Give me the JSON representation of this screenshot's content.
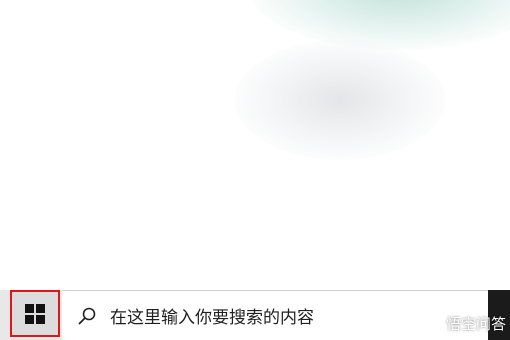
{
  "taskbar": {
    "start_icon": "windows-logo-icon",
    "search": {
      "icon": "search-icon",
      "placeholder": "在这里输入你要搜索的内容"
    }
  },
  "watermark": {
    "text": "悟空问答"
  },
  "colors": {
    "highlight_border": "#e0151b",
    "taskbar_bg": "#e8e8e8",
    "search_bg": "#ffffff",
    "taskbar_dark": "#1b1b1b"
  }
}
